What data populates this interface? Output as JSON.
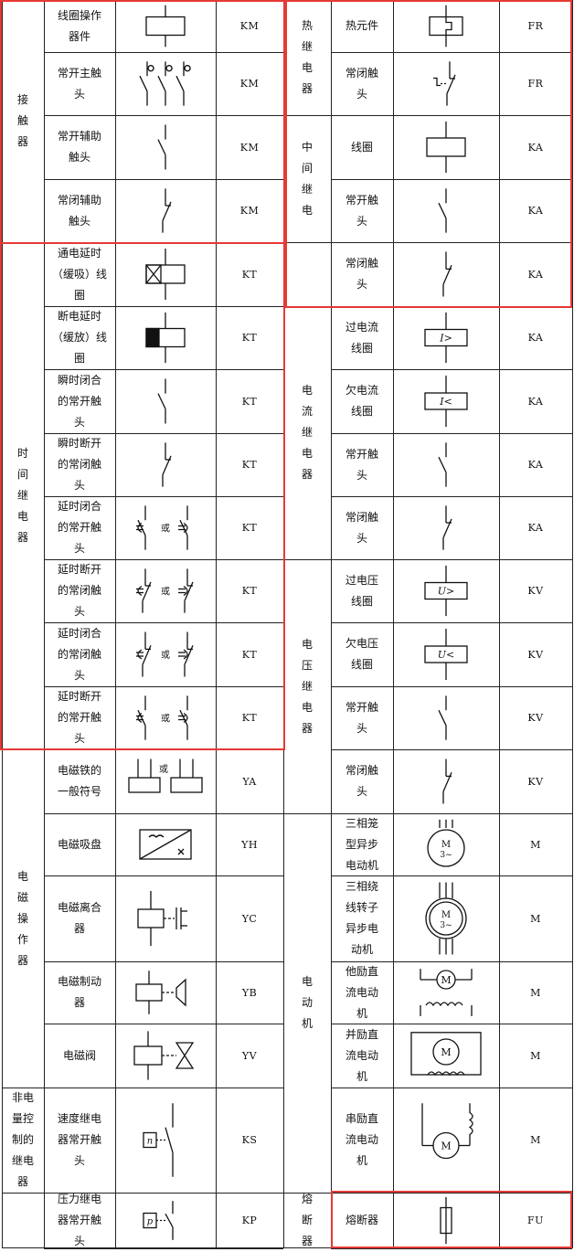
{
  "left_categories": [
    {
      "id": "contactor",
      "label": "接\n触\n器"
    },
    {
      "id": "time-relay",
      "label": "时\n间\n继\n电\n器"
    },
    {
      "id": "em-operator",
      "label": "电\n磁\n操\n作\n器"
    },
    {
      "id": "non-electric-relay",
      "label": "非电\n量控\n制的\n继电\n器"
    },
    {
      "id": "bottom-left",
      "label": ""
    }
  ],
  "right_categories": [
    {
      "id": "thermal-relay",
      "label": "热\n继\n电\n器"
    },
    {
      "id": "intermediate-relay",
      "label": "中\n间\n继\n电"
    },
    {
      "id": "current-relay",
      "label": "电\n流\n继\n电\n器"
    },
    {
      "id": "voltage-relay",
      "label": "电\n压\n继\n电\n器"
    },
    {
      "id": "motor",
      "label": "电\n动\n机"
    },
    {
      "id": "fuse-cat",
      "label": "熔\n断\n器"
    }
  ],
  "left_rows": [
    {
      "name": "线圈操作\n器件",
      "symbol": "coil",
      "code": "KM"
    },
    {
      "name": "常开主触\n头",
      "symbol": "main-no",
      "code": "KM"
    },
    {
      "name": "常开辅助\n触头",
      "symbol": "no-contact",
      "code": "KM"
    },
    {
      "name": "常闭辅助\n触头",
      "symbol": "nc-contact",
      "code": "KM"
    },
    {
      "name": "通电延时\n（缓吸）线\n圈",
      "symbol": "on-delay-coil",
      "code": "KT"
    },
    {
      "name": "断电延时\n（缓放）线\n圈",
      "symbol": "off-delay-coil",
      "code": "KT"
    },
    {
      "name": "瞬时闭合\n的常开触\n头",
      "symbol": "no-contact",
      "code": "KT"
    },
    {
      "name": "瞬时断开\n的常闭触\n头",
      "symbol": "nc-contact",
      "code": "KT"
    },
    {
      "name": "延时闭合\n的常开触\n头",
      "symbol": "delay-a",
      "code": "KT"
    },
    {
      "name": "延时断开\n的常闭触\n头",
      "symbol": "delay-b",
      "code": "KT"
    },
    {
      "name": "延时闭合\n的常闭触\n头",
      "symbol": "delay-c",
      "code": "KT"
    },
    {
      "name": "延时断开\n的常开触\n头",
      "symbol": "delay-d",
      "code": "KT"
    },
    {
      "name": "电磁铁的\n一般符号",
      "symbol": "em-general",
      "code": "YA"
    },
    {
      "name": "电磁吸盘",
      "symbol": "em-chuck",
      "code": "YH"
    },
    {
      "name": "电磁离合\n器",
      "symbol": "em-clutch",
      "code": "YC"
    },
    {
      "name": "电磁制动\n器",
      "symbol": "em-brake",
      "code": "YB"
    },
    {
      "name": "电磁阀",
      "symbol": "em-valve",
      "code": "YV"
    },
    {
      "name": "速度继电\n器常开触\n头",
      "symbol": "speed-relay",
      "code": "KS"
    },
    {
      "name": "压力继电\n器常开触\n头",
      "symbol": "pressure-relay",
      "code": "KP"
    }
  ],
  "right_rows": [
    {
      "name": "热元件",
      "symbol": "thermal",
      "code": "FR"
    },
    {
      "name": "常闭触\n头",
      "symbol": "thermal-nc",
      "code": "FR"
    },
    {
      "name": "线圈",
      "symbol": "coil",
      "code": "KA"
    },
    {
      "name": "常开触\n头",
      "symbol": "no-contact",
      "code": "KA"
    },
    {
      "name": "常闭触\n头",
      "symbol": "nc-contact",
      "code": "KA"
    },
    {
      "name": "过电流\n线圈",
      "symbol": "box-text",
      "box": "I>",
      "code": "KA"
    },
    {
      "name": "欠电流\n线圈",
      "symbol": "box-text",
      "box": "I<",
      "code": "KA"
    },
    {
      "name": "常开触\n头",
      "symbol": "no-contact",
      "code": "KA"
    },
    {
      "name": "常闭触\n头",
      "symbol": "nc-contact",
      "code": "KA"
    },
    {
      "name": "过电压\n线圈",
      "symbol": "box-text",
      "box": "U>",
      "code": "KV"
    },
    {
      "name": "欠电压\n线圈",
      "symbol": "box-text",
      "box": "U<",
      "code": "KV"
    },
    {
      "name": "常开触\n头",
      "symbol": "no-contact",
      "code": "KV"
    },
    {
      "name": "常闭触\n头",
      "symbol": "nc-contact",
      "code": "KV"
    },
    {
      "name": "三相笼\n型异步\n电动机",
      "symbol": "motor-cage",
      "motor_label": "M\n3~",
      "code": "M"
    },
    {
      "name": "三相绕\n线转子\n异步电\n动机",
      "symbol": "motor-wound",
      "motor_label": "M\n3~",
      "code": "M"
    },
    {
      "name": "他励直\n流电动\n机",
      "symbol": "dc-sep",
      "motor_label": "M",
      "code": "M"
    },
    {
      "name": "并励直\n流电动\n机",
      "symbol": "dc-shunt",
      "motor_label": "M",
      "code": "M"
    },
    {
      "name": "串励直\n流电动\n机",
      "symbol": "dc-series",
      "motor_label": "M",
      "code": "M"
    },
    {
      "name": "熔断器",
      "symbol": "fuse",
      "code": "FU"
    }
  ],
  "or_label": "或",
  "n_label": "n",
  "p_label": "p",
  "highlight_color": "#e53935"
}
